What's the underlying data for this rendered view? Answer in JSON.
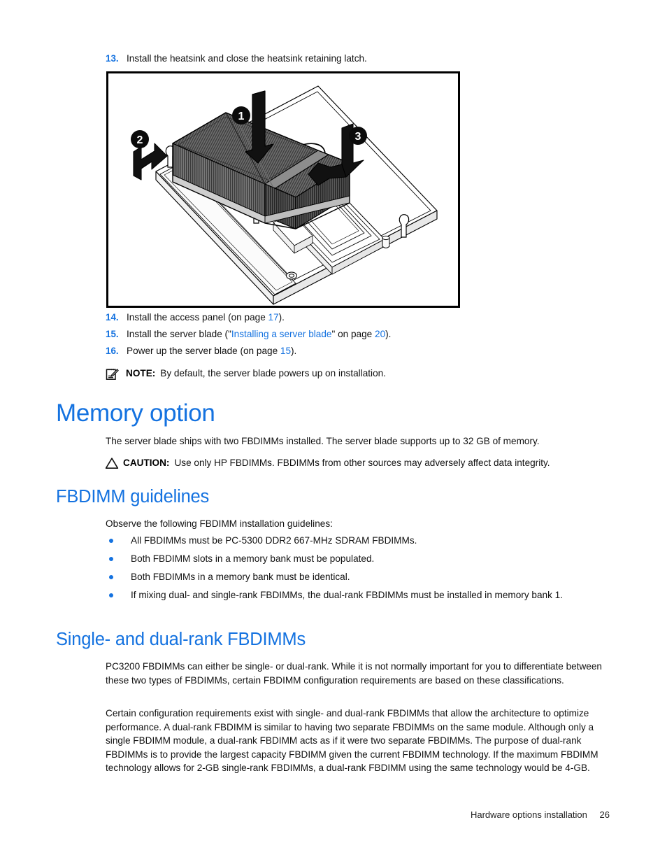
{
  "document": {
    "title": "Hardware options installation"
  },
  "steps": [
    {
      "num": "13.",
      "text": "Install the heatsink and close the heatsink retaining latch."
    }
  ],
  "figure": {
    "name": "heatsink-installation-illustration",
    "alt": "Line drawing of a server blade system board with heatsink being lowered onto the processor socket",
    "callouts": [
      {
        "id": "1",
        "label": "1",
        "meaning": "press-heatsink-down"
      },
      {
        "id": "2",
        "label": "2",
        "meaning": "engage-left-latch"
      },
      {
        "id": "3",
        "label": "3",
        "meaning": "close-right-retaining-latch"
      }
    ]
  },
  "steps_after_figure": [
    {
      "num": "14.",
      "parts": [
        {
          "t": "Install the access panel (on page ",
          "link": false
        },
        {
          "t": "17",
          "link": true
        },
        {
          "t": ").",
          "link": false
        }
      ]
    },
    {
      "num": "15.",
      "parts": [
        {
          "t": "Install the server blade (\"",
          "link": false
        },
        {
          "t": "Installing a server blade",
          "link": true
        },
        {
          "t": "\" on page ",
          "link": false
        },
        {
          "t": "20",
          "link": true
        },
        {
          "t": ").",
          "link": false
        }
      ]
    },
    {
      "num": "16.",
      "parts": [
        {
          "t": "Power up the server blade (on page ",
          "link": false
        },
        {
          "t": "15",
          "link": true
        },
        {
          "t": ").",
          "link": false
        }
      ]
    }
  ],
  "note": {
    "icon": "note-pad-pen-icon",
    "label": "NOTE:",
    "text": "By default, the server blade powers up on installation."
  },
  "memory_option": {
    "heading": "Memory option",
    "intro": "The server blade ships with two FBDIMMs installed. The server blade supports up to 32 GB of memory.",
    "caution": {
      "icon": "warning-triangle-icon",
      "label": "CAUTION:",
      "text": "Use only HP FBDIMMs. FBDIMMs from other sources may adversely affect data integrity."
    }
  },
  "fbdimm_guidelines": {
    "heading": "FBDIMM guidelines",
    "intro": "Observe the following FBDIMM installation guidelines:",
    "bullets": [
      "All FBDIMMs must be PC-5300 DDR2 667-MHz SDRAM FBDIMMs.",
      "Both FBDIMM slots in a memory bank must be populated.",
      "Both FBDIMMs in a memory bank must be identical.",
      "If mixing dual- and single-rank FBDIMMs, the dual-rank FBDIMMs must be installed in memory bank 1."
    ]
  },
  "single_dual_rank": {
    "heading": "Single- and dual-rank FBDIMMs",
    "paragraph1": "PC3200 FBDIMMs can either be single- or dual-rank. While it is not normally important for you to differentiate between these two types of FBDIMMs, certain FBDIMM configuration requirements are based on these classifications.",
    "paragraph2": "Certain configuration requirements exist with single- and dual-rank FBDIMMs that allow the architecture to optimize performance. A dual-rank FBDIMM is similar to having two separate FBDIMMs on the same module. Although only a single FBDIMM module, a dual-rank FBDIMM acts as if it were two separate FBDIMMs. The purpose of dual-rank FBDIMMs is to provide the largest capacity FBDIMM given the current FBDIMM technology. If the maximum FBDIMM technology allows for 2-GB single-rank FBDIMMs, a dual-rank FBDIMM using the same technology would be 4-GB."
  },
  "footer": {
    "section": "Hardware options installation",
    "page_number": "26"
  },
  "colors": {
    "accent_blue": "#1472e0",
    "text": "#111111"
  }
}
